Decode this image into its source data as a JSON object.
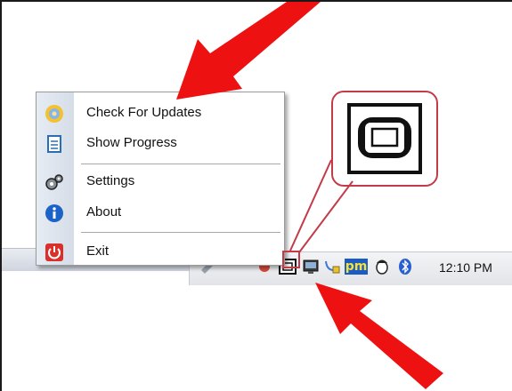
{
  "menu": {
    "items": [
      {
        "label": "Check For Updates",
        "icon": "check-updates-icon"
      },
      {
        "label": "Show Progress",
        "icon": "clipboard-icon"
      },
      {
        "label": "Settings",
        "icon": "gears-icon"
      },
      {
        "label": "About",
        "icon": "info-icon"
      },
      {
        "label": "Exit",
        "icon": "power-icon"
      }
    ]
  },
  "tray": {
    "clock": "12:10 PM",
    "pm_badge": "pm",
    "icons": [
      "app-tray-icon",
      "network-icon",
      "pm-icon",
      "mouse-icon",
      "bluetooth-icon"
    ]
  },
  "colors": {
    "arrow": "#ee1111",
    "callout_border": "#c43a48",
    "menu_exit_icon": "#d9302c",
    "about_icon": "#1c63c8"
  }
}
